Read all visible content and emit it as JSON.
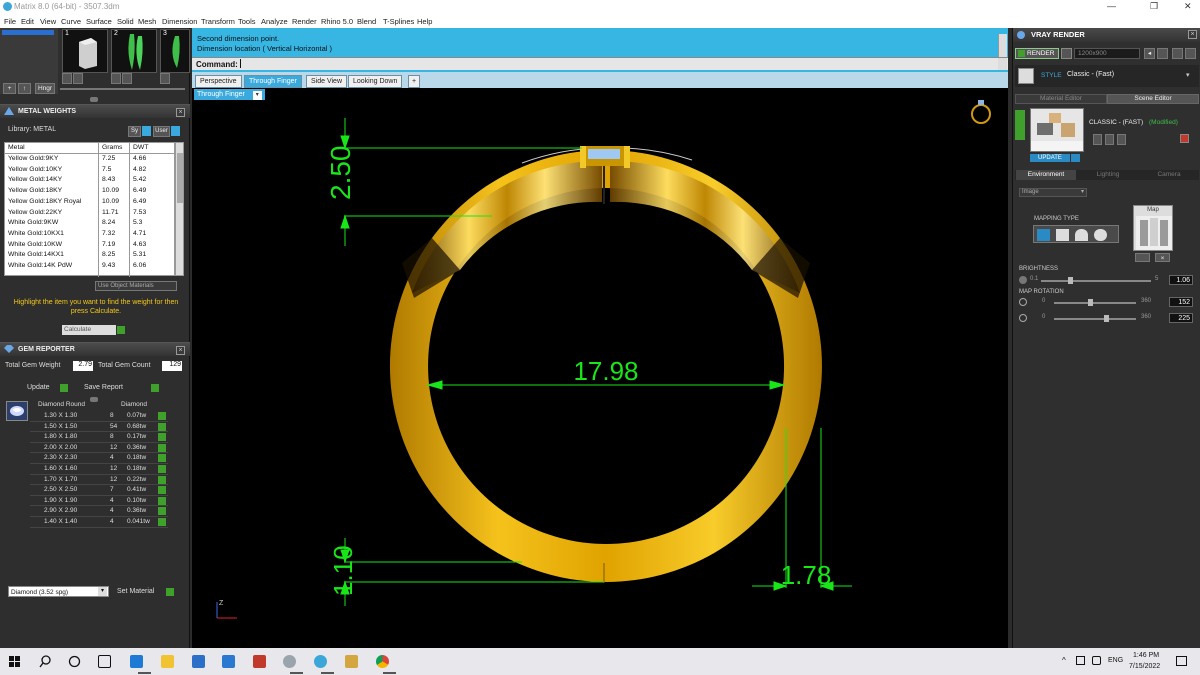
{
  "window": {
    "title": "Matrix 8.0 (64-bit) - 3507.3dm",
    "controls": [
      "—",
      "❐",
      "✕"
    ]
  },
  "menu": [
    "File",
    "Edit",
    "View",
    "Curve",
    "Surface",
    "Solid",
    "Mesh",
    "Dimension",
    "Transform",
    "Tools",
    "Analyze",
    "Render",
    "Rhino 5.0",
    "Blend",
    "T-Splines",
    "Help"
  ],
  "thumb_nums": [
    "1",
    "2",
    "3"
  ],
  "toolbar_left": {
    "plus": "+",
    "up": "↑",
    "hinge": "Hngr"
  },
  "metal": {
    "title": "METAL WEIGHTS",
    "library_label": "Library: METAL",
    "sys_btn": "Sy",
    "user_btn": "User",
    "columns": [
      "Metal",
      "Grams",
      "DWT"
    ],
    "rows": [
      [
        "Yellow Gold:9KY",
        "7.25",
        "4.66"
      ],
      [
        "Yellow Gold:10KY",
        "7.5",
        "4.82"
      ],
      [
        "Yellow Gold:14KY",
        "8.43",
        "5.42"
      ],
      [
        "Yellow Gold:18KY",
        "10.09",
        "6.49"
      ],
      [
        "Yellow Gold:18KY Royal",
        "10.09",
        "6.49"
      ],
      [
        "Yellow Gold:22KY",
        "11.71",
        "7.53"
      ],
      [
        "White Gold:9KW",
        "8.24",
        "5.3"
      ],
      [
        "White Gold:10KX1",
        "7.32",
        "4.71"
      ],
      [
        "White Gold:10KW",
        "7.19",
        "4.63"
      ],
      [
        "White Gold:14KX1",
        "8.25",
        "5.31"
      ],
      [
        "White Gold:14K PdW",
        "9.43",
        "6.06"
      ]
    ],
    "use_object_materials": "Use Object Materials",
    "hint": "Highlight the item you want to find the weight for then press Calculate.",
    "calculate": "Calculate"
  },
  "gem": {
    "title": "GEM REPORTER",
    "total_weight_label": "Total Gem Weight",
    "total_weight": "2.79",
    "total_count_label": "Total Gem Count",
    "total_count": "129",
    "update": "Update",
    "save_report": "Save Report",
    "col_shape": "Diamond Round",
    "col_material": "Diamond",
    "rows": [
      [
        "1.30 X 1.30",
        "8",
        "0.07tw"
      ],
      [
        "1.50 X 1.50",
        "54",
        "0.68tw"
      ],
      [
        "1.80 X 1.80",
        "8",
        "0.17tw"
      ],
      [
        "2.00 X 2.00",
        "12",
        "0.36tw"
      ],
      [
        "2.30 X 2.30",
        "4",
        "0.18tw"
      ],
      [
        "1.60 X 1.60",
        "12",
        "0.18tw"
      ],
      [
        "1.70 X 1.70",
        "12",
        "0.22tw"
      ],
      [
        "2.50 X 2.50",
        "7",
        "0.41tw"
      ],
      [
        "1.90 X 1.90",
        "4",
        "0.10tw"
      ],
      [
        "2.90 X 2.90",
        "4",
        "0.36tw"
      ],
      [
        "1.40 X 1.40",
        "4",
        "0.041tw"
      ]
    ],
    "material_select": "Diamond    (3.52 spg)",
    "set_material": "Set Material"
  },
  "command": {
    "prompt1": "Second dimension point.",
    "prompt2": "Dimension location ( Vertical  Horizontal )",
    "label": "Command:"
  },
  "tabs": [
    "Perspective",
    "Through Finger",
    "Side View",
    "Looking Down",
    "+"
  ],
  "active_view": "Through Finger",
  "viewport": {
    "dims": {
      "top": "2.50",
      "inner": "17.98",
      "bottom": "1.10",
      "width": "1.78"
    },
    "axis_label": "Z",
    "colors": {
      "dim": "#19e619",
      "gold": "#d9a400",
      "bg": "#000000"
    }
  },
  "vray": {
    "title": "VRAY RENDER",
    "render_btn": "RENDER",
    "resolution": "1200x900",
    "style_label": "STYLE",
    "style_value": "Classic - (Fast)",
    "tab_material": "Material Editor",
    "tab_scene": "Scene Editor",
    "preset_name": "CLASSIC - (FAST)",
    "preset_status": "(Modified)",
    "update": "UPDATE",
    "subtabs": [
      "Environment",
      "Lighting",
      "Camera"
    ],
    "env_type": "Image",
    "mapping_type": "MAPPING TYPE",
    "map_label": "Map",
    "brightness_label": "BRIGHTNESS",
    "brightness_min": "0.1",
    "brightness_max": "5",
    "brightness_value": "1.06",
    "map_rotation_label": "MAP ROTATION",
    "rot1_min": "0",
    "rot1_max": "360",
    "rot1_value": "152",
    "rot2_min": "0",
    "rot2_max": "360",
    "rot2_value": "225"
  },
  "taskbar": {
    "lang": "ENG",
    "time": "1:46 PM",
    "date": "7/15/2022"
  }
}
